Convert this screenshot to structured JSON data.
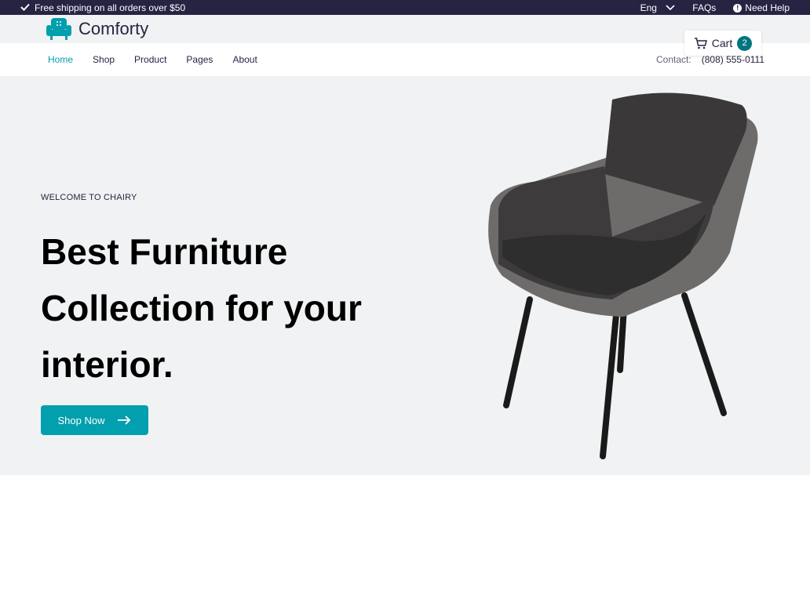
{
  "topbar": {
    "shipping": "Free shipping on all orders over $50",
    "language": "Eng",
    "faqs": "FAQs",
    "help": "Need Help"
  },
  "header": {
    "brand": "Comforty",
    "cart_label": "Cart",
    "cart_count": "2"
  },
  "nav": {
    "items": [
      "Home",
      "Shop",
      "Product",
      "Pages",
      "About"
    ],
    "contact_label": "Contact:",
    "contact_phone": "(808) 555-0111"
  },
  "hero": {
    "welcome": "WELCOME TO CHAIRY",
    "title": "Best Furniture Collection for your interior.",
    "button": "Shop Now"
  },
  "colors": {
    "accent": "#029fae",
    "dark": "#272343",
    "badge": "#007580"
  }
}
